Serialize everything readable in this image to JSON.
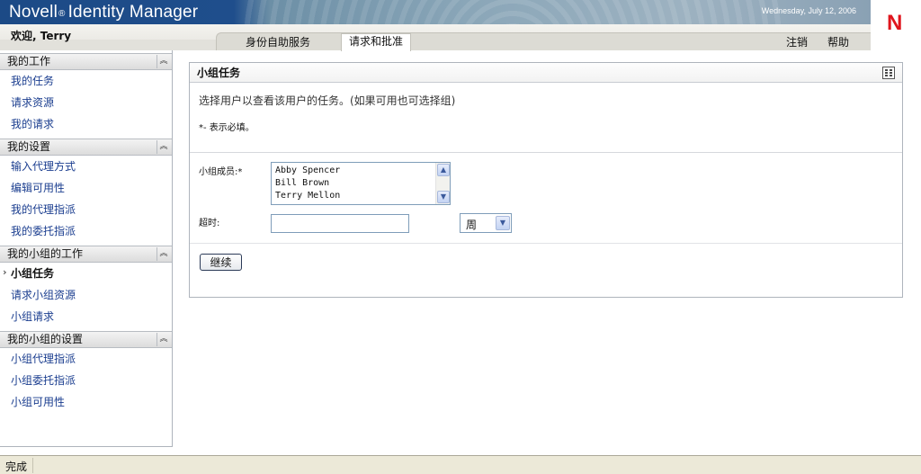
{
  "header": {
    "app_title_part1": "Novell",
    "app_title_reg": "®",
    "app_title_part2": "Identity Manager",
    "date": "Wednesday, July 12, 2006",
    "logo_letter": "N",
    "welcome": "欢迎, Terry",
    "tabs": [
      {
        "label": "身份自助服务",
        "active": false
      },
      {
        "label": "请求和批准",
        "active": true
      }
    ],
    "logout_label": "注销",
    "help_label": "帮助"
  },
  "sidebar": {
    "sections": [
      {
        "title": "我的工作",
        "items": [
          "我的任务",
          "请求资源",
          "我的请求"
        ]
      },
      {
        "title": "我的设置",
        "items": [
          "输入代理方式",
          "编辑可用性",
          "我的代理指派",
          "我的委托指派"
        ]
      },
      {
        "title": "我的小组的工作",
        "items": [
          "小组任务",
          "请求小组资源",
          "小组请求"
        ]
      },
      {
        "title": "我的小组的设置",
        "items": [
          "小组代理指派",
          "小组委托指派",
          "小组可用性"
        ]
      }
    ],
    "active_item": "小组任务",
    "collapse_glyph": "︽"
  },
  "panel": {
    "title": "小组任务",
    "description": "选择用户以查看该用户的任务。(如果可用也可选择组)",
    "required_note": "*- 表示必填。",
    "members_label": "小组成员:*",
    "members": [
      "Abby Spencer",
      "Bill Brown",
      "Terry Mellon"
    ],
    "timeout_label": "超时:",
    "timeout_value": "",
    "unit_value": "周",
    "continue_label": "继续"
  },
  "status": {
    "text": "完成"
  },
  "colors": {
    "banner": "#1f4e8c",
    "link": "#1a3d8f",
    "logo": "#e0151d"
  }
}
